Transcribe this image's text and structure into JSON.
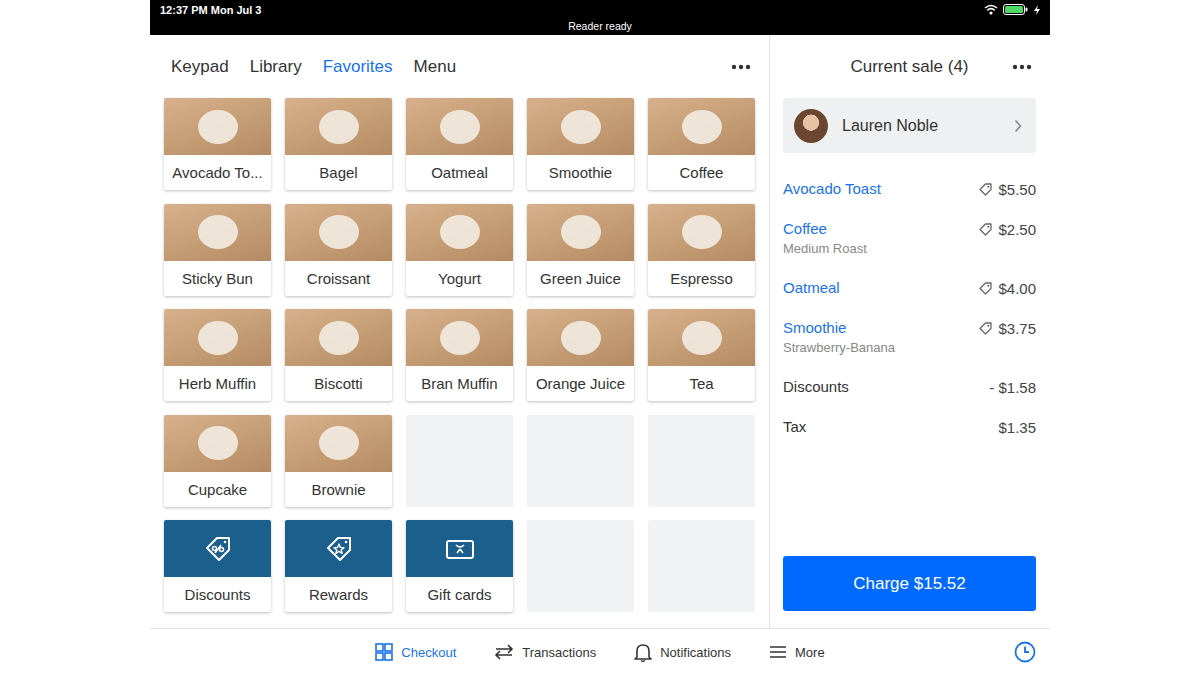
{
  "status_bar": {
    "time": "12:37 PM  Mon Jul 3",
    "message": "Reader ready"
  },
  "tabs": [
    {
      "label": "Keypad",
      "selected": false
    },
    {
      "label": "Library",
      "selected": false
    },
    {
      "label": "Favorites",
      "selected": true
    },
    {
      "label": "Menu",
      "selected": false
    }
  ],
  "tiles": [
    {
      "label": "Avocado To...",
      "kind": "item"
    },
    {
      "label": "Bagel",
      "kind": "item"
    },
    {
      "label": "Oatmeal",
      "kind": "item"
    },
    {
      "label": "Smoothie",
      "kind": "item"
    },
    {
      "label": "Coffee",
      "kind": "item"
    },
    {
      "label": "Sticky Bun",
      "kind": "item"
    },
    {
      "label": "Croissant",
      "kind": "item"
    },
    {
      "label": "Yogurt",
      "kind": "item"
    },
    {
      "label": "Green Juice",
      "kind": "item"
    },
    {
      "label": "Espresso",
      "kind": "item"
    },
    {
      "label": "Herb Muffin",
      "kind": "item"
    },
    {
      "label": "Biscotti",
      "kind": "item"
    },
    {
      "label": "Bran Muffin",
      "kind": "item"
    },
    {
      "label": "Orange Juice",
      "kind": "item"
    },
    {
      "label": "Tea",
      "kind": "item"
    },
    {
      "label": "Cupcake",
      "kind": "item"
    },
    {
      "label": "Brownie",
      "kind": "item"
    },
    {
      "label": "",
      "kind": "empty"
    },
    {
      "label": "",
      "kind": "empty"
    },
    {
      "label": "",
      "kind": "empty"
    },
    {
      "label": "Discounts",
      "kind": "action"
    },
    {
      "label": "Rewards",
      "kind": "action"
    },
    {
      "label": "Gift cards",
      "kind": "action"
    },
    {
      "label": "",
      "kind": "empty"
    },
    {
      "label": "",
      "kind": "empty"
    }
  ],
  "sale": {
    "title": "Current sale (4)",
    "customer": {
      "name": "Lauren Noble"
    },
    "items": [
      {
        "name": "Avocado Toast",
        "note": "",
        "price": "$5.50",
        "discounted": true
      },
      {
        "name": "Coffee",
        "note": "Medium Roast",
        "price": "$2.50",
        "discounted": true
      },
      {
        "name": "Oatmeal",
        "note": "",
        "price": "$4.00",
        "discounted": true
      },
      {
        "name": "Smoothie",
        "note": "Strawberry-Banana",
        "price": "$3.75",
        "discounted": true
      }
    ],
    "summary": [
      {
        "label": "Discounts",
        "value": "- $1.58"
      },
      {
        "label": "Tax",
        "value": "$1.35"
      }
    ],
    "charge_button": "Charge $15.52"
  },
  "bottom_nav": [
    {
      "label": "Checkout",
      "selected": true
    },
    {
      "label": "Transactions",
      "selected": false
    },
    {
      "label": "Notifications",
      "selected": false
    },
    {
      "label": "More",
      "selected": false
    }
  ]
}
